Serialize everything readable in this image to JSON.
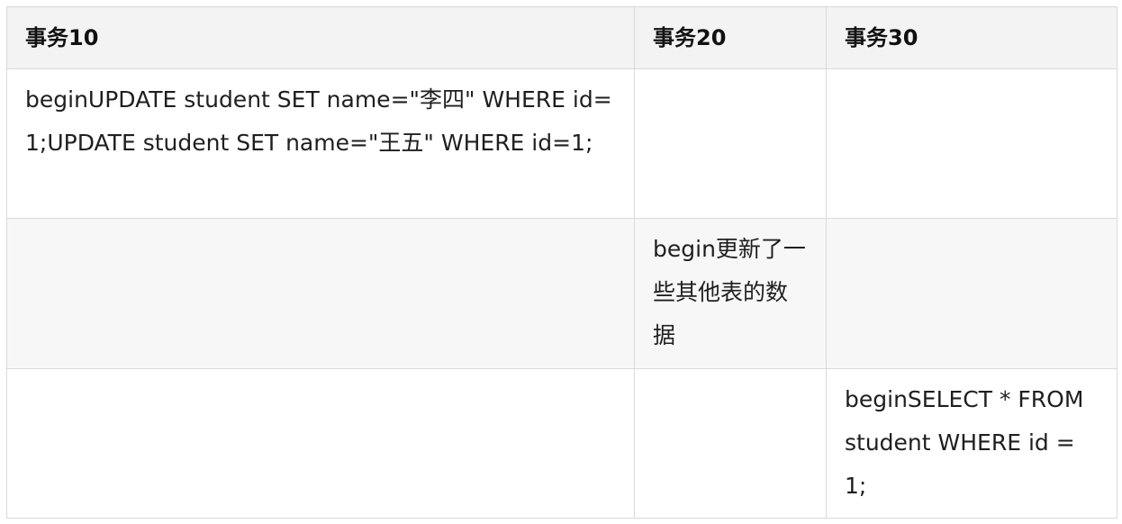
{
  "table": {
    "headers": [
      "事务10",
      "事务20",
      "事务30"
    ],
    "rows": [
      [
        "beginUPDATE student SET name=\"李四\" WHERE id=1;UPDATE student SET name=\"王五\" WHERE id=1;",
        "",
        ""
      ],
      [
        "",
        "begin更新了一些其他表的数据",
        ""
      ],
      [
        "",
        "",
        "beginSELECT * FROM student WHERE id = 1;"
      ]
    ]
  }
}
